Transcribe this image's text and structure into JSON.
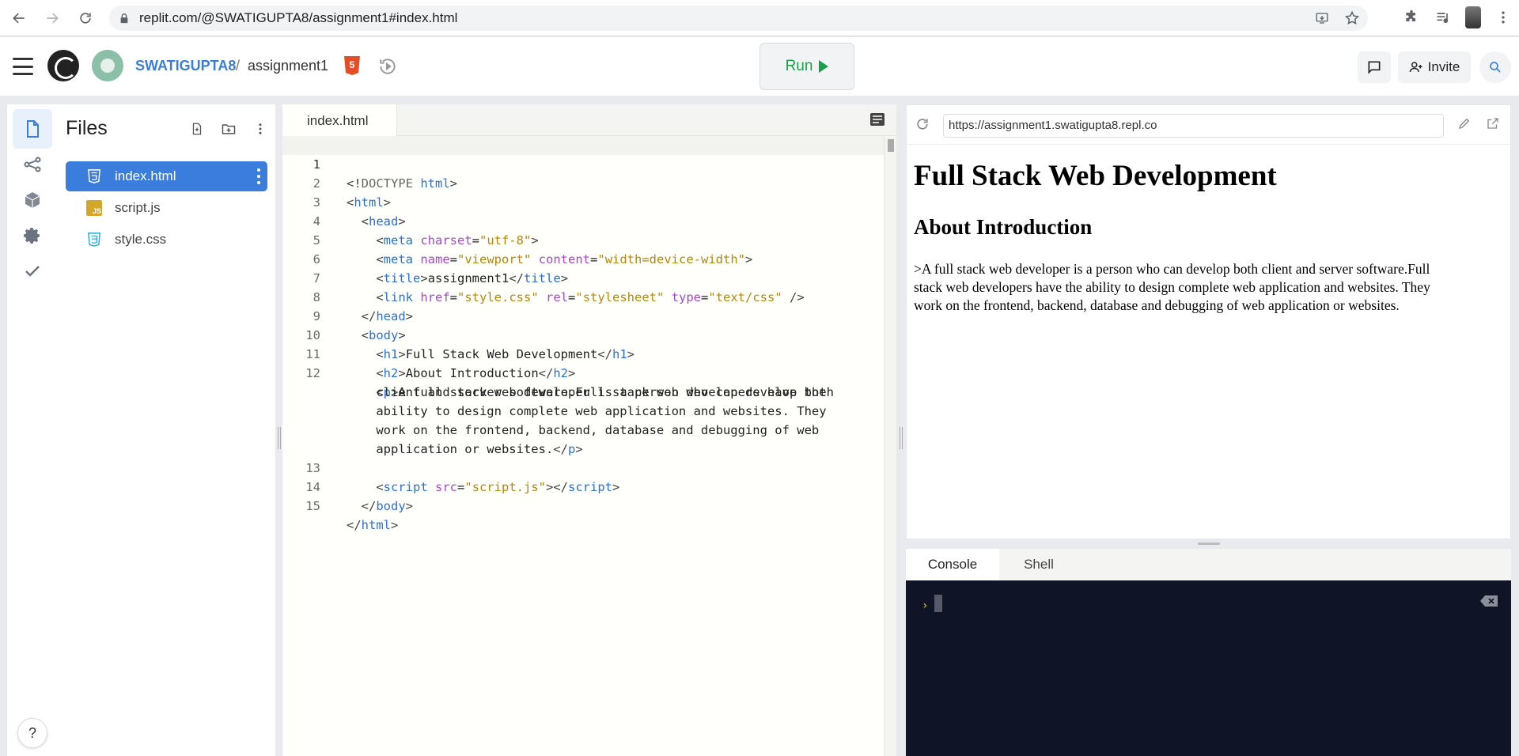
{
  "browser": {
    "url": "replit.com/@SWATIGUPTA8/assignment1#index.html"
  },
  "header": {
    "owner": "SWATIGUPTA8",
    "separator": "/",
    "repl_name": "assignment1",
    "run_label": "Run",
    "invite_label": "Invite"
  },
  "files": {
    "title": "Files",
    "items": [
      {
        "name": "index.html",
        "icon": "html-file-icon"
      },
      {
        "name": "script.js",
        "icon": "js-file-icon"
      },
      {
        "name": "style.css",
        "icon": "css-file-icon"
      }
    ]
  },
  "editor": {
    "tab": "index.html",
    "line_numbers": [
      "1",
      "2",
      "3",
      "4",
      "5",
      "6",
      "7",
      "8",
      "9",
      "10",
      "11",
      "12",
      "13",
      "14",
      "15"
    ]
  },
  "webview": {
    "url": "https://assignment1.swatigupta8.repl.co",
    "h1": "Full Stack Web Development",
    "h2": "About Introduction",
    "p_line1": ">A full stack web developer is a person who can develop both client and server software.Full",
    "p_line2": "stack web developers have the ability to design complete web application and websites. They",
    "p_line3": "work on the frontend, backend, database and debugging of web application or websites."
  },
  "console": {
    "tabs": [
      "Console",
      "Shell"
    ],
    "prompt": "›"
  },
  "help": "?"
}
